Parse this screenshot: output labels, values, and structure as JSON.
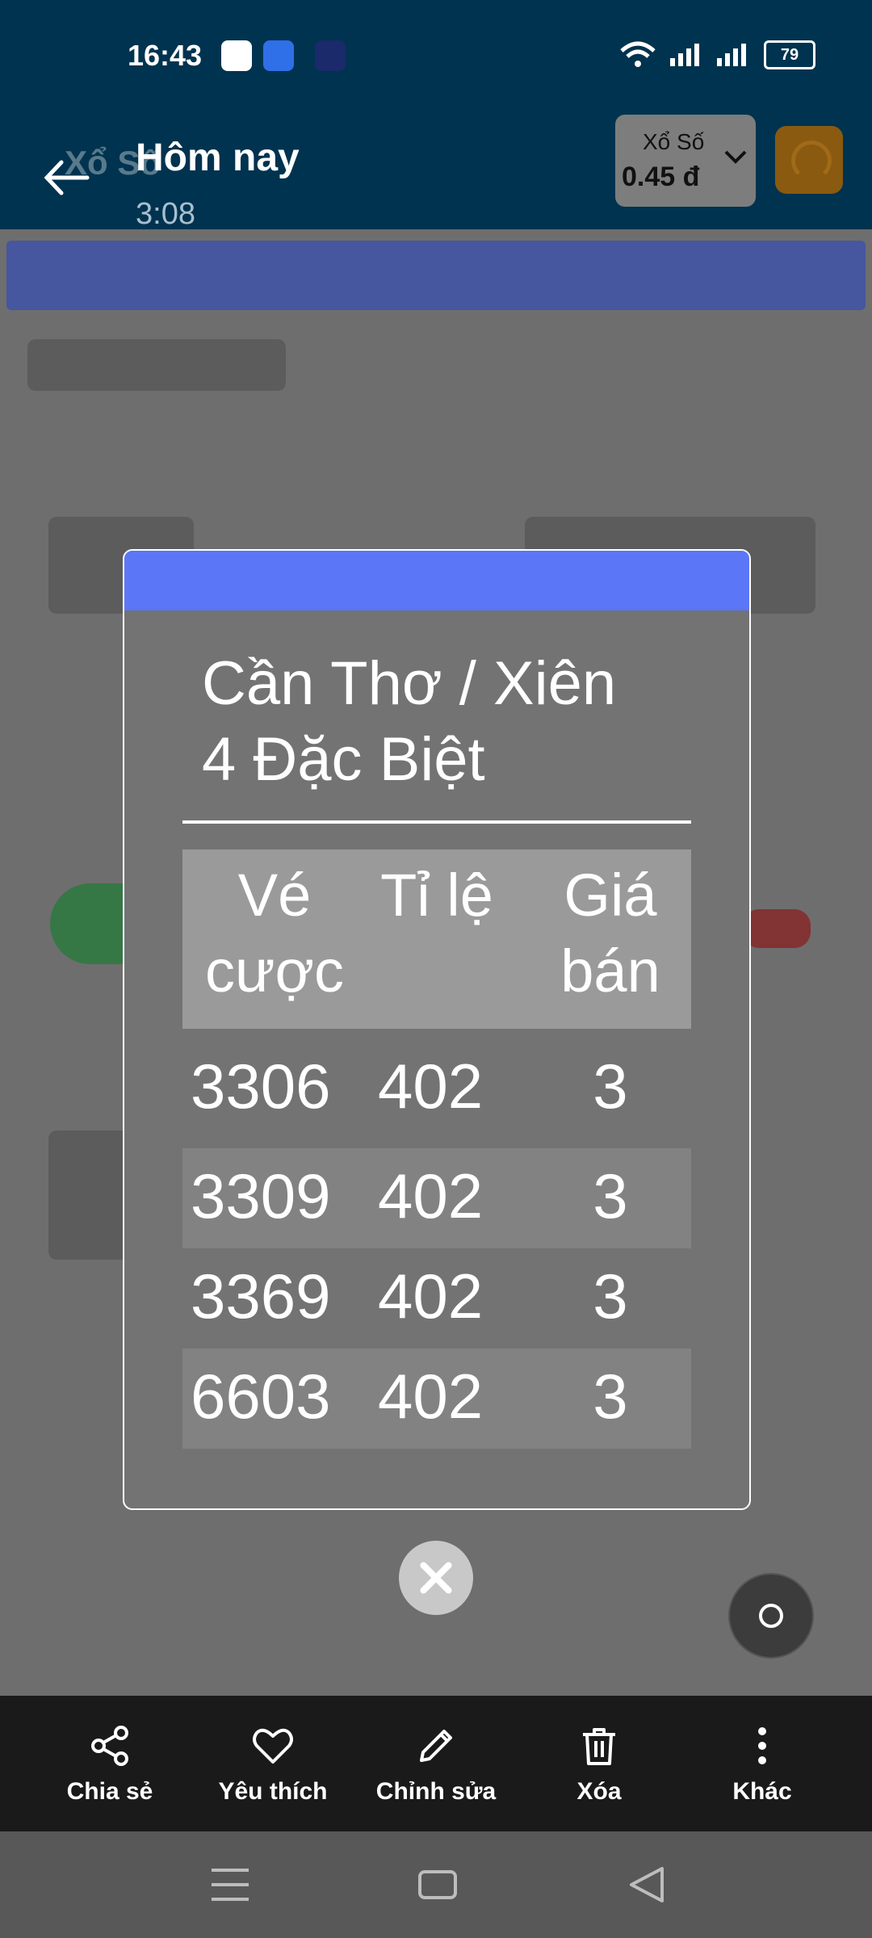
{
  "status_bar": {
    "time": "16:43",
    "battery": "79"
  },
  "header": {
    "title": "Hôm nay",
    "subtitle": "3:08",
    "background_title": "Xổ Số",
    "lottery_label": "Xổ Số",
    "lottery_price": "0.45 đ"
  },
  "modal": {
    "title": "Cần Thơ / Xiên 4 Đặc Biệt",
    "columns": [
      "Vé cược",
      "Tỉ lệ",
      "Giá bán"
    ],
    "rows": [
      [
        "3306",
        "402",
        "3"
      ],
      [
        "3309",
        "402",
        "3"
      ],
      [
        "3369",
        "402",
        "3"
      ],
      [
        "6603",
        "402",
        "3"
      ]
    ]
  },
  "actions": {
    "share": "Chia sẻ",
    "favorite": "Yêu thích",
    "edit": "Chỉnh sửa",
    "delete": "Xóa",
    "more": "Khác"
  },
  "colors": {
    "header_bg": "#00334f",
    "modal_bar": "#5b76f6",
    "action_bar": "#1a1a1a"
  }
}
